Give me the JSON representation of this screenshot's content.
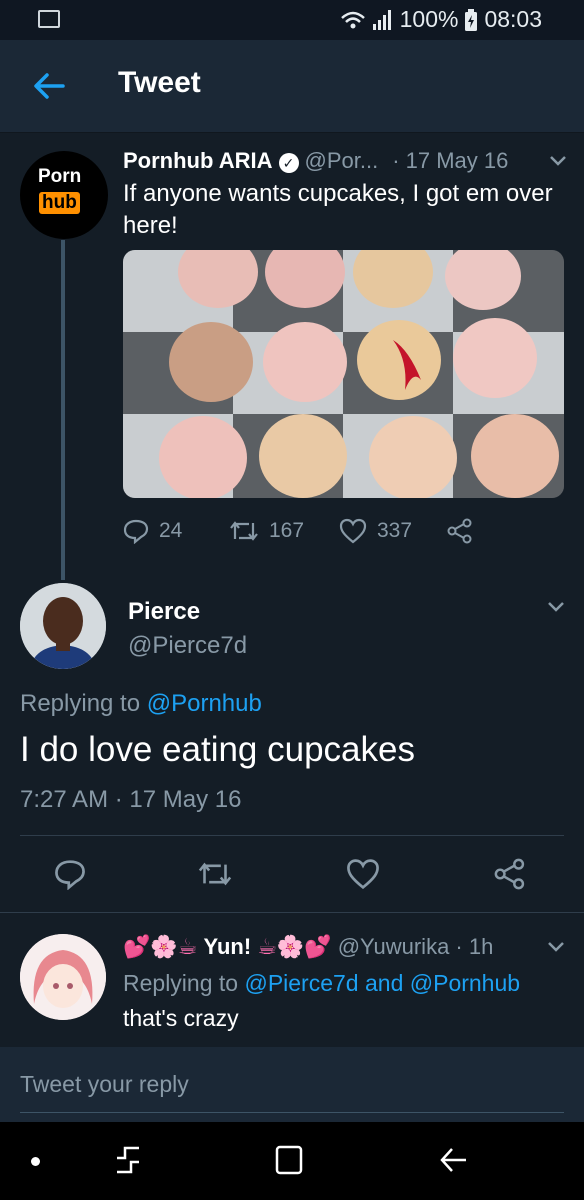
{
  "status_bar": {
    "battery": "100%",
    "time": "08:03"
  },
  "app_bar": {
    "title": "Tweet"
  },
  "tweet_main": {
    "avatar_text_top": "Porn",
    "avatar_text_bottom": "hub",
    "name": "Pornhub ARIA",
    "handle": "@Por...",
    "date": "· 17 May 16",
    "text": "If anyone wants cupcakes, I got em over here!",
    "replies": "24",
    "retweets": "167",
    "likes": "337"
  },
  "tweet_reply": {
    "name": "Pierce",
    "handle": "@Pierce7d",
    "replying_prefix": "Replying to",
    "replying_to": "@Pornhub",
    "text": "I do love eating cupcakes",
    "timestamp": "7:27 AM · 17 May 16"
  },
  "tweet_comment": {
    "name": "Yun!",
    "handle": "@Yuwurika · 1h",
    "replying_prefix": "Replying to",
    "replying_to_1": "@Pierce7d",
    "replying_and": "and",
    "replying_to_2": "@Pornhub",
    "text": "that's crazy"
  },
  "reply_input": {
    "placeholder": "Tweet your reply"
  },
  "colors": {
    "background": "#141d26",
    "bar": "#1b2836",
    "accent": "#1da1f2",
    "muted": "#8899a6",
    "brand_orange": "#ff9000"
  },
  "icons": [
    "image-icon",
    "wifi-icon",
    "signal-icon",
    "battery-icon",
    "back-arrow-icon",
    "verified-icon",
    "chevron-down-icon",
    "reply-icon",
    "retweet-icon",
    "like-icon",
    "share-icon",
    "recent-apps-icon",
    "home-icon",
    "nav-back-icon"
  ]
}
